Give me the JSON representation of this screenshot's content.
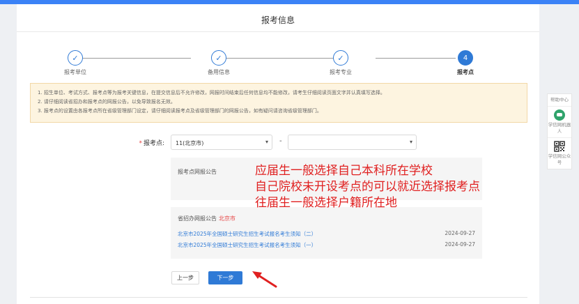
{
  "page": {
    "title": "报考信息"
  },
  "steps": [
    {
      "label": "报考单位",
      "icon": "check-icon",
      "glyph": "✓",
      "state": "done"
    },
    {
      "label": "备用信息",
      "icon": "check-icon",
      "glyph": "✓",
      "state": "done"
    },
    {
      "label": "报考专业",
      "icon": "check-icon",
      "glyph": "✓",
      "state": "done"
    },
    {
      "label": "报考点",
      "number": "4",
      "state": "active"
    }
  ],
  "notice": {
    "lines": [
      "1. 招生单位、考试方式、报考点等为报考关键信息，在提交信息后不允许修改，网报时间结束后任何信息均不能修改，请考生仔细阅读页面文字并认真填写选择。",
      "2. 请仔细阅读省招办和报考点的网报公告，以免导致报名无效。",
      "3. 报考点的设置由各报考点所在省级管理部门设定，请仔细阅读报考点及省级管理部门的网报公告，如有疑问请咨询省级管理部门。"
    ]
  },
  "form": {
    "required_mark": "*",
    "label": "报考点:",
    "province_select": {
      "value": "11(北京市)"
    },
    "site_select": {
      "value": ""
    },
    "separator": "-"
  },
  "site_announcement": {
    "header": "报考点网报公告"
  },
  "province_announcement": {
    "header": "省招办网报公告",
    "city": "北京市",
    "items": [
      {
        "title": "北京市2025年全国硕士研究生招生考试报名考生须知（二）",
        "date": "2024-09-27"
      },
      {
        "title": "北京市2025年全国硕士研究生招生考试报名考生须知（一）",
        "date": "2024-09-27"
      }
    ]
  },
  "buttons": {
    "prev": "上一步",
    "next": "下一步"
  },
  "annotation": {
    "lines": [
      "应届生一般选择自己本科所在学校",
      "自己院校未开设考点的可以就近选择报考点",
      "往届生一般选择户籍所在地"
    ],
    "color": "#e02020"
  },
  "sidebar": {
    "help": "帮助中心",
    "robot": "学信网机器人",
    "wechat": "学信网公众号"
  },
  "colors": {
    "primary": "#2f7ad6",
    "notice_bg": "#fdf4e0",
    "required": "#e64545"
  },
  "icons": {
    "caret": "▾"
  }
}
